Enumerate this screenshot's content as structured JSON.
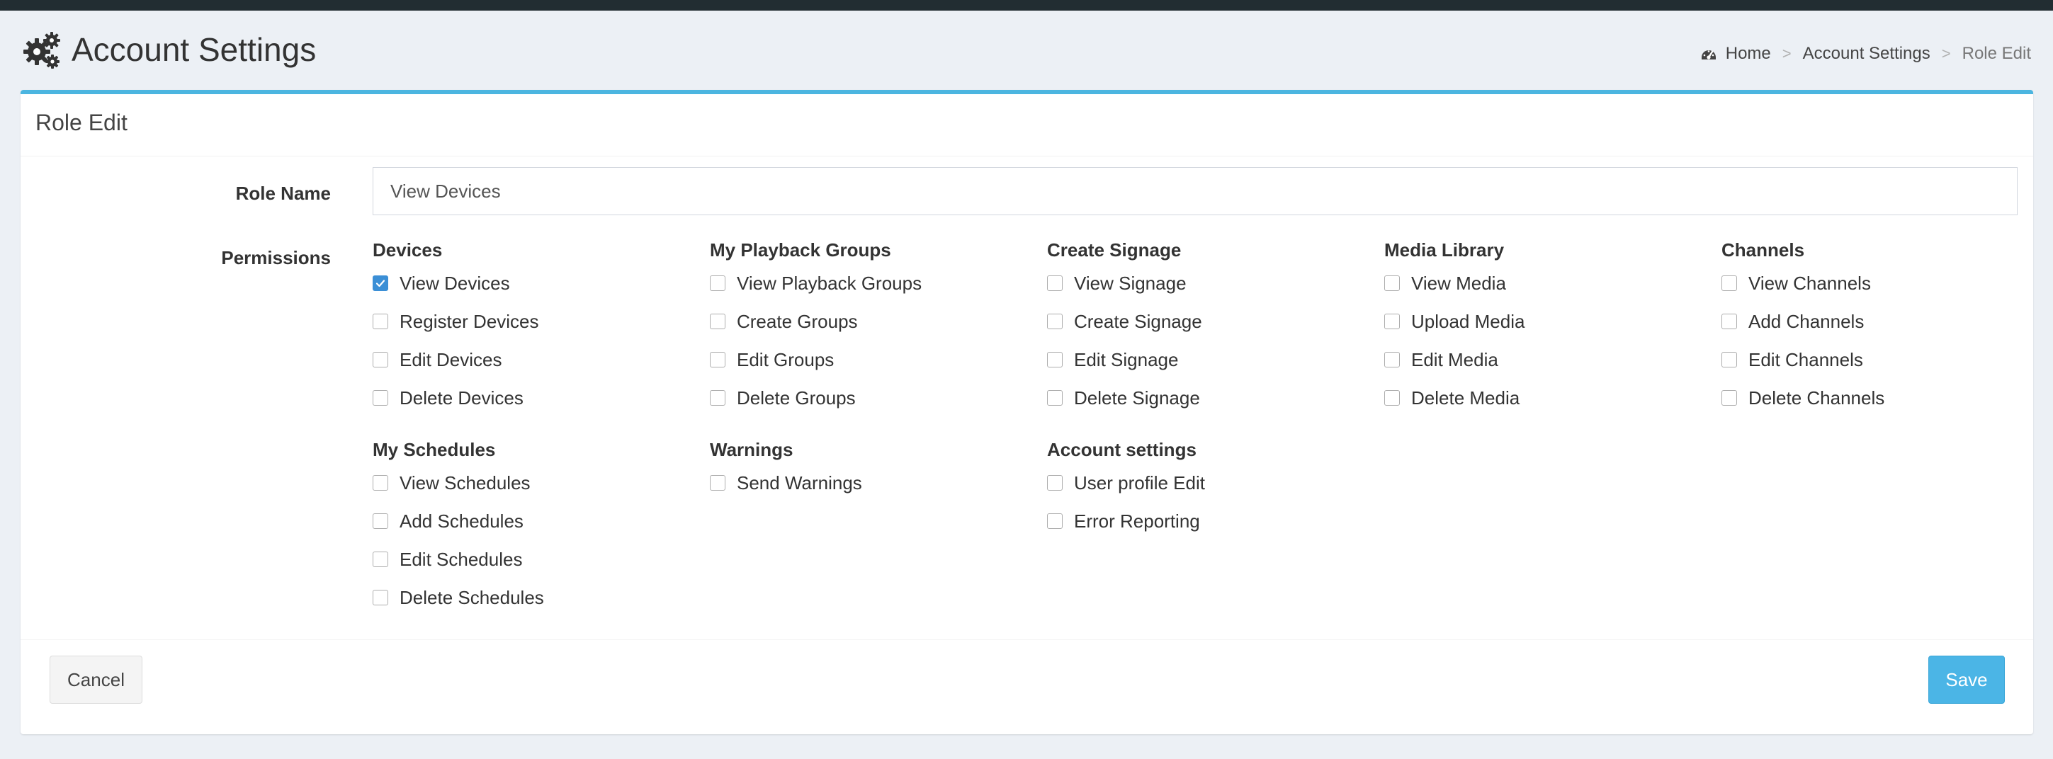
{
  "header": {
    "title": "Account Settings",
    "title_icon": "gears-icon",
    "breadcrumb": [
      {
        "label": "Home",
        "icon": "dashboard-icon"
      },
      {
        "label": "Account Settings"
      },
      {
        "label": "Role Edit"
      }
    ],
    "breadcrumb_separator": ">"
  },
  "box": {
    "title": "Role Edit",
    "role_name_label": "Role Name",
    "role_name_value": "View Devices",
    "permissions_label": "Permissions",
    "groups": [
      {
        "title": "Devices",
        "items": [
          {
            "label": "View Devices",
            "checked": true
          },
          {
            "label": "Register Devices",
            "checked": false
          },
          {
            "label": "Edit Devices",
            "checked": false
          },
          {
            "label": "Delete Devices",
            "checked": false
          }
        ]
      },
      {
        "title": "My Playback Groups",
        "items": [
          {
            "label": "View Playback Groups",
            "checked": false
          },
          {
            "label": "Create Groups",
            "checked": false
          },
          {
            "label": "Edit Groups",
            "checked": false
          },
          {
            "label": "Delete Groups",
            "checked": false
          }
        ]
      },
      {
        "title": "Create Signage",
        "items": [
          {
            "label": "View Signage",
            "checked": false
          },
          {
            "label": "Create Signage",
            "checked": false
          },
          {
            "label": "Edit Signage",
            "checked": false
          },
          {
            "label": "Delete Signage",
            "checked": false
          }
        ]
      },
      {
        "title": "Media Library",
        "items": [
          {
            "label": "View Media",
            "checked": false
          },
          {
            "label": "Upload Media",
            "checked": false
          },
          {
            "label": "Edit Media",
            "checked": false
          },
          {
            "label": "Delete Media",
            "checked": false
          }
        ]
      },
      {
        "title": "Channels",
        "items": [
          {
            "label": "View Channels",
            "checked": false
          },
          {
            "label": "Add Channels",
            "checked": false
          },
          {
            "label": "Edit Channels",
            "checked": false
          },
          {
            "label": "Delete Channels",
            "checked": false
          }
        ]
      },
      {
        "title": "My Schedules",
        "items": [
          {
            "label": "View Schedules",
            "checked": false
          },
          {
            "label": "Add Schedules",
            "checked": false
          },
          {
            "label": "Edit Schedules",
            "checked": false
          },
          {
            "label": "Delete Schedules",
            "checked": false
          }
        ]
      },
      {
        "title": "Warnings",
        "items": [
          {
            "label": "Send Warnings",
            "checked": false
          }
        ]
      },
      {
        "title": "Account settings",
        "items": [
          {
            "label": "User profile Edit",
            "checked": false
          },
          {
            "label": "Error Reporting",
            "checked": false
          }
        ]
      }
    ]
  },
  "footer": {
    "cancel_label": "Cancel",
    "save_label": "Save"
  },
  "colors": {
    "accent": "#4bb5e0",
    "save_button": "#4bb5e6",
    "checkbox_checked": "#3b8fd6",
    "topbar": "#222d32",
    "background": "#ecf0f5"
  }
}
